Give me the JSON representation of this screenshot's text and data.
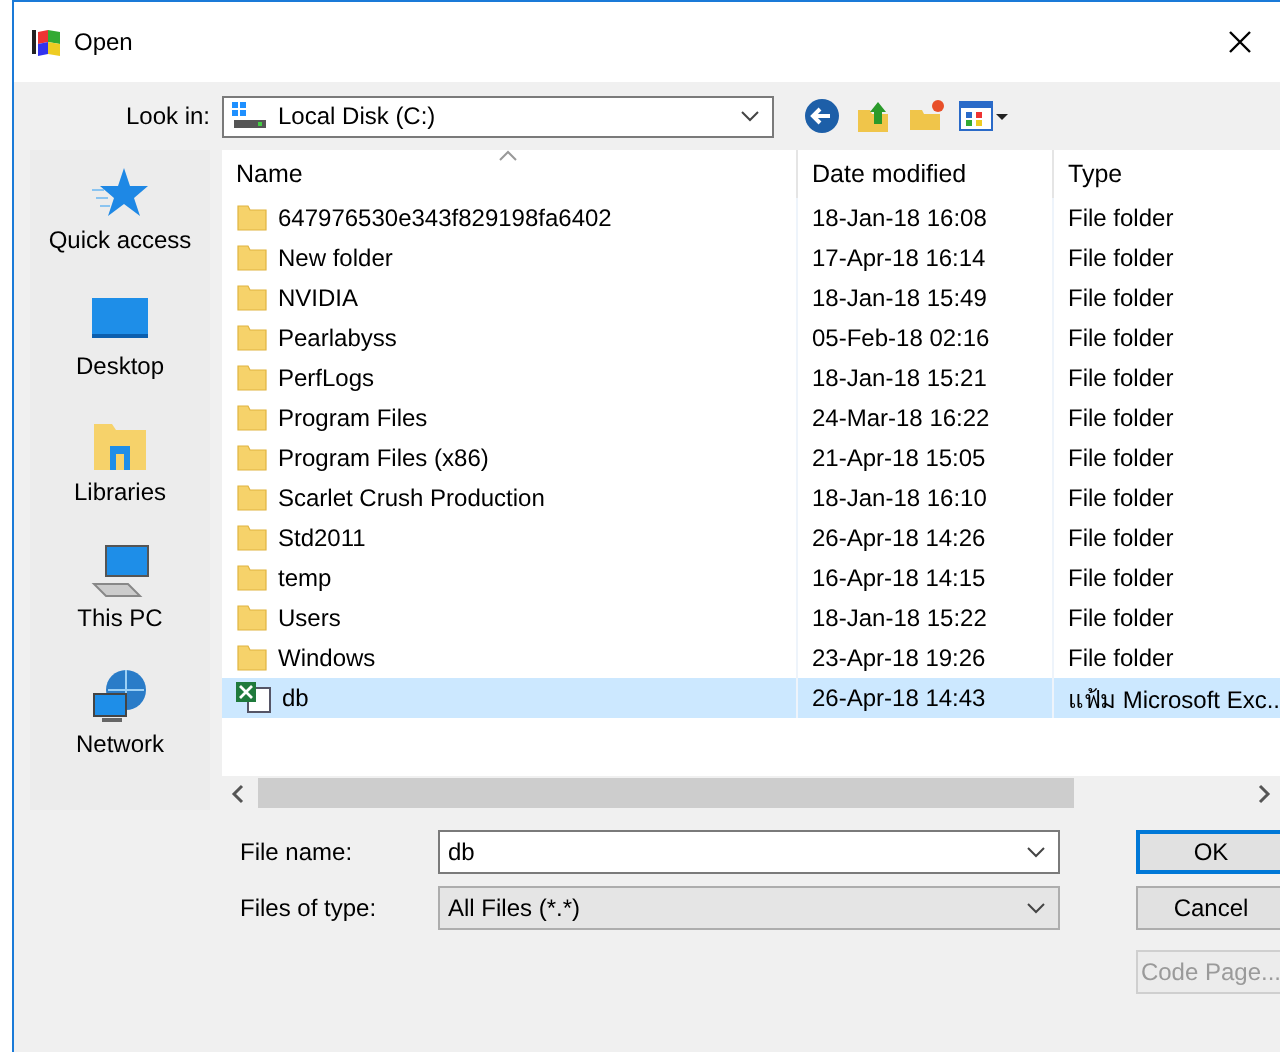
{
  "window": {
    "title": "Open"
  },
  "look_in": {
    "label": "Look in:",
    "value": "Local Disk (C:)"
  },
  "places": [
    {
      "label": "Quick access",
      "kind": "star"
    },
    {
      "label": "Desktop",
      "kind": "desktop"
    },
    {
      "label": "Libraries",
      "kind": "libraries"
    },
    {
      "label": "This PC",
      "kind": "pc"
    },
    {
      "label": "Network",
      "kind": "network"
    }
  ],
  "table": {
    "columns": [
      "Name",
      "Date modified",
      "Type"
    ],
    "rows": [
      {
        "name": "647976530e343f829198fa6402",
        "date": "18-Jan-18 16:08",
        "type": "File folder",
        "kind": "folder",
        "selected": false
      },
      {
        "name": "New folder",
        "date": "17-Apr-18 16:14",
        "type": "File folder",
        "kind": "folder",
        "selected": false
      },
      {
        "name": "NVIDIA",
        "date": "18-Jan-18 15:49",
        "type": "File folder",
        "kind": "folder",
        "selected": false
      },
      {
        "name": "Pearlabyss",
        "date": "05-Feb-18 02:16",
        "type": "File folder",
        "kind": "folder",
        "selected": false
      },
      {
        "name": "PerfLogs",
        "date": "18-Jan-18 15:21",
        "type": "File folder",
        "kind": "folder",
        "selected": false
      },
      {
        "name": "Program Files",
        "date": "24-Mar-18 16:22",
        "type": "File folder",
        "kind": "folder",
        "selected": false
      },
      {
        "name": "Program Files (x86)",
        "date": "21-Apr-18 15:05",
        "type": "File folder",
        "kind": "folder",
        "selected": false
      },
      {
        "name": "Scarlet Crush Production",
        "date": "18-Jan-18 16:10",
        "type": "File folder",
        "kind": "folder",
        "selected": false
      },
      {
        "name": "Std2011",
        "date": "26-Apr-18 14:26",
        "type": "File folder",
        "kind": "folder",
        "selected": false
      },
      {
        "name": "temp",
        "date": "16-Apr-18 14:15",
        "type": "File folder",
        "kind": "folder",
        "selected": false
      },
      {
        "name": "Users",
        "date": "18-Jan-18 15:22",
        "type": "File folder",
        "kind": "folder",
        "selected": false
      },
      {
        "name": "Windows",
        "date": "23-Apr-18 19:26",
        "type": "File folder",
        "kind": "folder",
        "selected": false
      },
      {
        "name": "db",
        "date": "26-Apr-18 14:43",
        "type": "แฟ้ม Microsoft Exc...",
        "kind": "excel",
        "selected": true
      }
    ]
  },
  "file_name": {
    "label": "File name:",
    "value": "db"
  },
  "file_type": {
    "label": "Files of type:",
    "value": "All Files (*.*)"
  },
  "buttons": [
    {
      "label": "OK",
      "disabled": false,
      "default": true
    },
    {
      "label": "Cancel",
      "disabled": false,
      "default": false
    },
    {
      "label": "Code Page...",
      "disabled": true,
      "default": false
    }
  ]
}
